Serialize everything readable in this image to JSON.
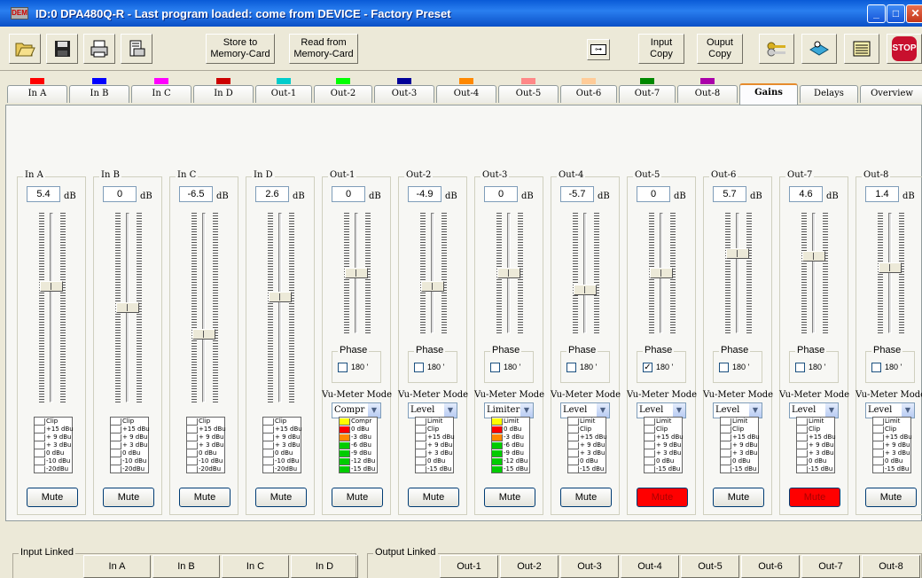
{
  "window": {
    "title": "ID:0 DPA480Q-R - Last program loaded: come from DEVICE - Factory Preset",
    "app_icon": "DEM"
  },
  "toolbar": {
    "open_icon": "folder-open-icon",
    "save_icon": "floppy-disk-icon",
    "print_icon": "printer-icon",
    "print_preview_icon": "print-preview-icon",
    "store_label": "Store to\nMemory-Card",
    "read_label": "Read from\nMemory-Card",
    "lock_icon": "lock-key-icon",
    "input_copy_label": "Input\nCopy",
    "output_copy_label": "Ouput\nCopy",
    "keys_icon": "keys-icon",
    "device_icon": "device-icon",
    "notes_icon": "notes-icon",
    "stop_label": "STOP"
  },
  "tabs": [
    {
      "label": "In A",
      "color": "#ff0000"
    },
    {
      "label": "In B",
      "color": "#0000ff"
    },
    {
      "label": "In C",
      "color": "#ff00ff"
    },
    {
      "label": "In D",
      "color": "#cc0000"
    },
    {
      "label": "Out-1",
      "color": "#00cccc"
    },
    {
      "label": "Out-2",
      "color": "#00ff00"
    },
    {
      "label": "Out-3",
      "color": "#000099"
    },
    {
      "label": "Out-4",
      "color": "#ff8800"
    },
    {
      "label": "Out-5",
      "color": "#ff8888"
    },
    {
      "label": "Out-6",
      "color": "#ffcc99"
    },
    {
      "label": "Out-7",
      "color": "#008800"
    },
    {
      "label": "Out-8",
      "color": "#aa00aa"
    },
    {
      "label": "Gains",
      "color": null
    },
    {
      "label": "Delays",
      "color": null
    },
    {
      "label": "Overview",
      "color": null
    }
  ],
  "strings": {
    "db": "dB",
    "phase": "Phase",
    "phase_val": "180 '",
    "vu_mode": "Vu-Meter Mode",
    "mute": "Mute"
  },
  "channels": [
    {
      "name": "In A",
      "gain": "5.4",
      "level": 0.62,
      "type": "in",
      "meter": [
        "Clip",
        "+15 dBu",
        "+ 9 dBu",
        "+ 3 dBu",
        "0 dBu",
        "-10 dBu",
        "-20dBu"
      ],
      "lit": [],
      "mute_on": false
    },
    {
      "name": "In B",
      "gain": "0",
      "level": 0.5,
      "type": "in",
      "meter": [
        "Clip",
        "+15 dBu",
        "+ 9 dBu",
        "+ 3 dBu",
        "0 dBu",
        "-10 dBu",
        "-20dBu"
      ],
      "lit": [],
      "mute_on": false
    },
    {
      "name": "In C",
      "gain": "-6.5",
      "level": 0.35,
      "type": "in",
      "meter": [
        "Clip",
        "+15 dBu",
        "+ 9 dBu",
        "+ 3 dBu",
        "0 dBu",
        "-10 dBu",
        "-20dBu"
      ],
      "lit": [],
      "mute_on": false
    },
    {
      "name": "In D",
      "gain": "2.6",
      "level": 0.56,
      "type": "in",
      "meter": [
        "Clip",
        "+15 dBu",
        "+ 9 dBu",
        "+ 3 dBu",
        "0 dBu",
        "-10 dBu",
        "-20dBu"
      ],
      "lit": [],
      "mute_on": false
    },
    {
      "name": "Out-1",
      "gain": "0",
      "level": 0.5,
      "type": "out",
      "phase": false,
      "mode": "Compr",
      "meter": [
        "Compr",
        "0 dBu",
        "-3 dBu",
        "-6 dBu",
        "-9 dBu",
        "-12 dBu",
        "-15 dBu"
      ],
      "lit": [
        "#ffff00",
        "#ff0000",
        "#ff8800",
        "#00cc00",
        "#00cc00",
        "#00cc00",
        "#00cc00"
      ],
      "mute_on": false
    },
    {
      "name": "Out-2",
      "gain": "-4.9",
      "level": 0.38,
      "type": "out",
      "phase": false,
      "mode": "Level",
      "meter": [
        "Limit",
        "Clip",
        "+15 dBu",
        "+ 9 dBu",
        "+ 3 dBu",
        "0 dBu",
        "-15 dBu"
      ],
      "lit": [],
      "mute_on": false
    },
    {
      "name": "Out-3",
      "gain": "0",
      "level": 0.5,
      "type": "out",
      "phase": false,
      "mode": "Limiter",
      "meter": [
        "Limit",
        "0 dBu",
        "-3 dBu",
        "-6 dBu",
        "-9 dBu",
        "-12 dBu",
        "-15 dBu"
      ],
      "lit": [
        "#ffff00",
        "#ff0000",
        "#ff8800",
        "#00cc00",
        "#00cc00",
        "#00cc00",
        "#00cc00"
      ],
      "mute_on": false
    },
    {
      "name": "Out-4",
      "gain": "-5.7",
      "level": 0.35,
      "type": "out",
      "phase": false,
      "mode": "Level",
      "meter": [
        "Limit",
        "Clip",
        "+15 dBu",
        "+ 9 dBu",
        "+ 3 dBu",
        "0 dBu",
        "-15 dBu"
      ],
      "lit": [],
      "mute_on": false
    },
    {
      "name": "Out-5",
      "gain": "0",
      "level": 0.5,
      "type": "out",
      "phase": true,
      "mode": "Level",
      "meter": [
        "Limit",
        "Clip",
        "+15 dBu",
        "+ 9 dBu",
        "+ 3 dBu",
        "0 dBu",
        "-15 dBu"
      ],
      "lit": [],
      "mute_on": true
    },
    {
      "name": "Out-6",
      "gain": "5.7",
      "level": 0.68,
      "type": "out",
      "phase": false,
      "mode": "Level",
      "meter": [
        "Limit",
        "Clip",
        "+15 dBu",
        "+ 9 dBu",
        "+ 3 dBu",
        "0 dBu",
        "-15 dBu"
      ],
      "lit": [],
      "mute_on": false
    },
    {
      "name": "Out-7",
      "gain": "4.6",
      "level": 0.65,
      "type": "out",
      "phase": false,
      "mode": "Level",
      "meter": [
        "Limit",
        "Clip",
        "+15 dBu",
        "+ 9 dBu",
        "+ 3 dBu",
        "0 dBu",
        "-15 dBu"
      ],
      "lit": [],
      "mute_on": true
    },
    {
      "name": "Out-8",
      "gain": "1.4",
      "level": 0.55,
      "type": "out",
      "phase": false,
      "mode": "Level",
      "meter": [
        "Limit",
        "Clip",
        "+15 dBu",
        "+ 9 dBu",
        "+ 3 dBu",
        "0 dBu",
        "-15 dBu"
      ],
      "lit": [],
      "mute_on": false
    }
  ],
  "bottom": {
    "input_linked_label": "Input Linked",
    "input_buttons": [
      "In A",
      "In B",
      "In C",
      "In D"
    ],
    "output_linked_label": "Output Linked",
    "output_buttons": [
      "Out-1",
      "Out-2",
      "Out-3",
      "Out-4",
      "Out-5",
      "Out-6",
      "Out-7",
      "Out-8"
    ]
  }
}
